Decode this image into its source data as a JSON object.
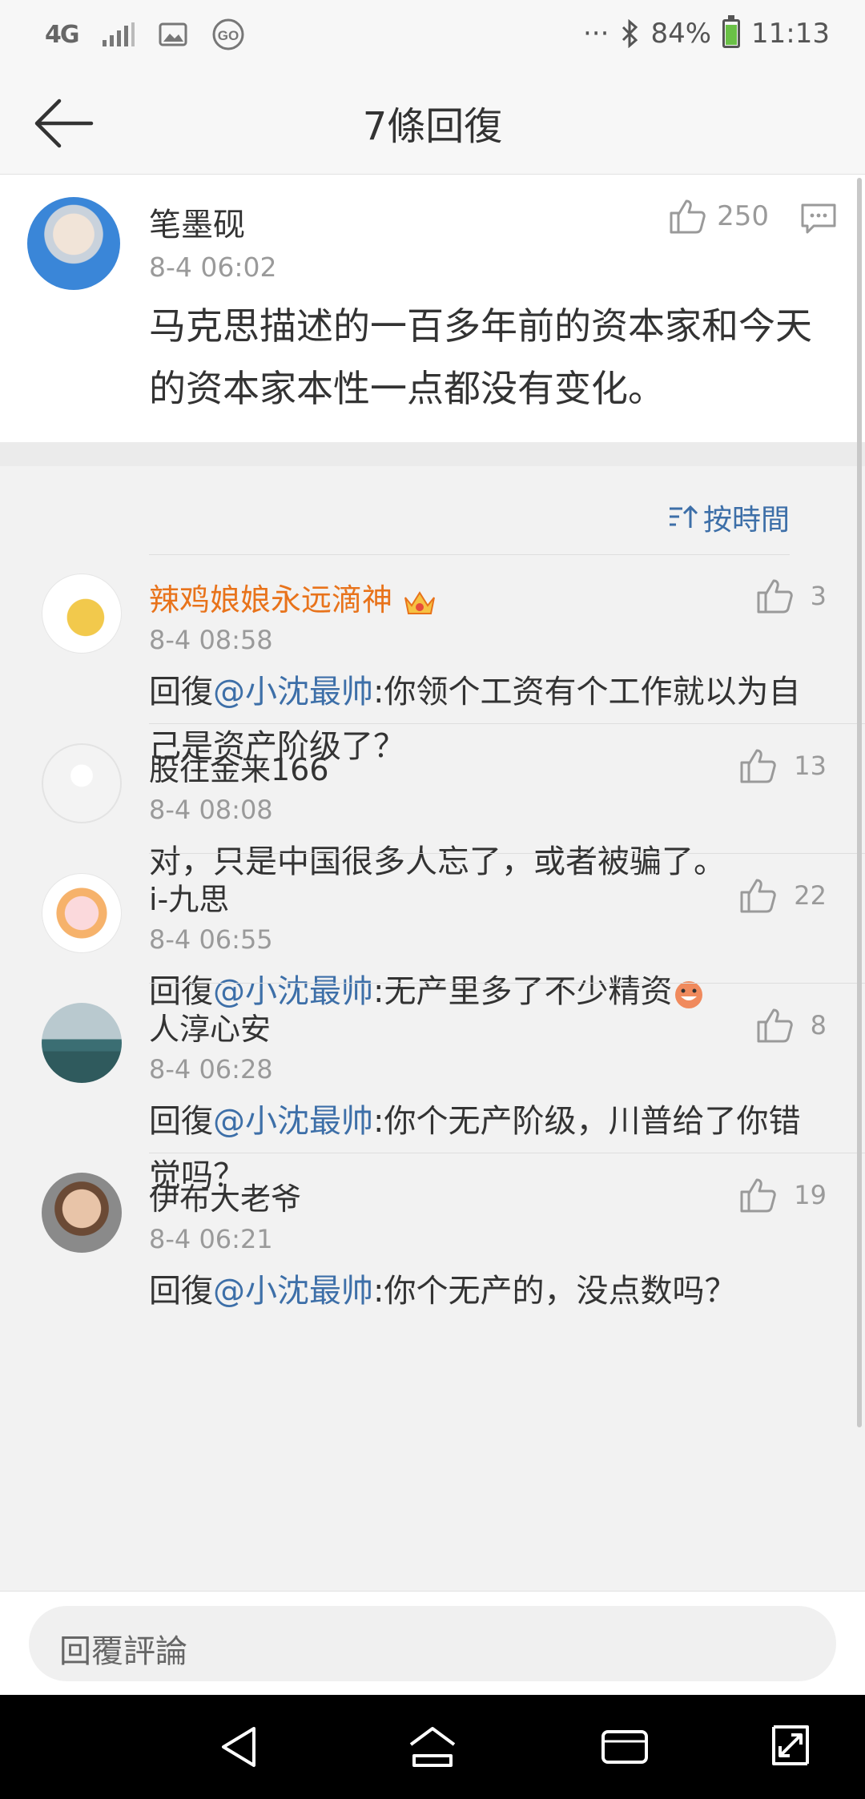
{
  "status_bar": {
    "network": "4G",
    "battery": "84%",
    "time": "11:13",
    "icons": [
      "signal-icon",
      "image-icon",
      "go-icon",
      "more-dots-icon",
      "bluetooth-icon",
      "battery-icon"
    ],
    "battery_level": 0.84
  },
  "header": {
    "title": "7條回復"
  },
  "post": {
    "username": "笔墨砚",
    "time": "8-4 06:02",
    "like_count": "250",
    "body": "马克思描述的一百多年前的资本家和今天的资本家本性一点都没有变化。"
  },
  "sort": {
    "label": "按時間"
  },
  "comments": [
    {
      "username": "辣鸡娘娘永远滴神",
      "time": "8-4 08:58",
      "likes": "3",
      "reply_prefix": "回復",
      "mention": "@小沈最帅",
      "text": ":你领个工资有个工作就以为自己是资产阶级了？"
    },
    {
      "username": "股往金来166",
      "time": "8-4 08:08",
      "likes": "13",
      "reply_prefix": "",
      "mention": "",
      "text": "对，只是中国很多人忘了，或者被骗了。"
    },
    {
      "username": "i-九思",
      "time": "8-4 06:55",
      "likes": "22",
      "reply_prefix": "回復",
      "mention": "@小沈最帅",
      "text": ":无产里多了不少精资"
    },
    {
      "username": "人淳心安",
      "time": "8-4 06:28",
      "likes": "8",
      "reply_prefix": "回復",
      "mention": "@小沈最帅",
      "text": ":你个无产阶级，川普给了你错觉吗？"
    },
    {
      "username": "伊布大老爷",
      "time": "8-4 06:21",
      "likes": "19",
      "reply_prefix": "回復",
      "mention": "@小沈最帅",
      "text": ":你个无产的，没点数吗？"
    }
  ],
  "reply_bar": {
    "placeholder": "回覆評論"
  },
  "colors": {
    "accent": "#3d6fa8",
    "vip_name": "#e8731b"
  }
}
